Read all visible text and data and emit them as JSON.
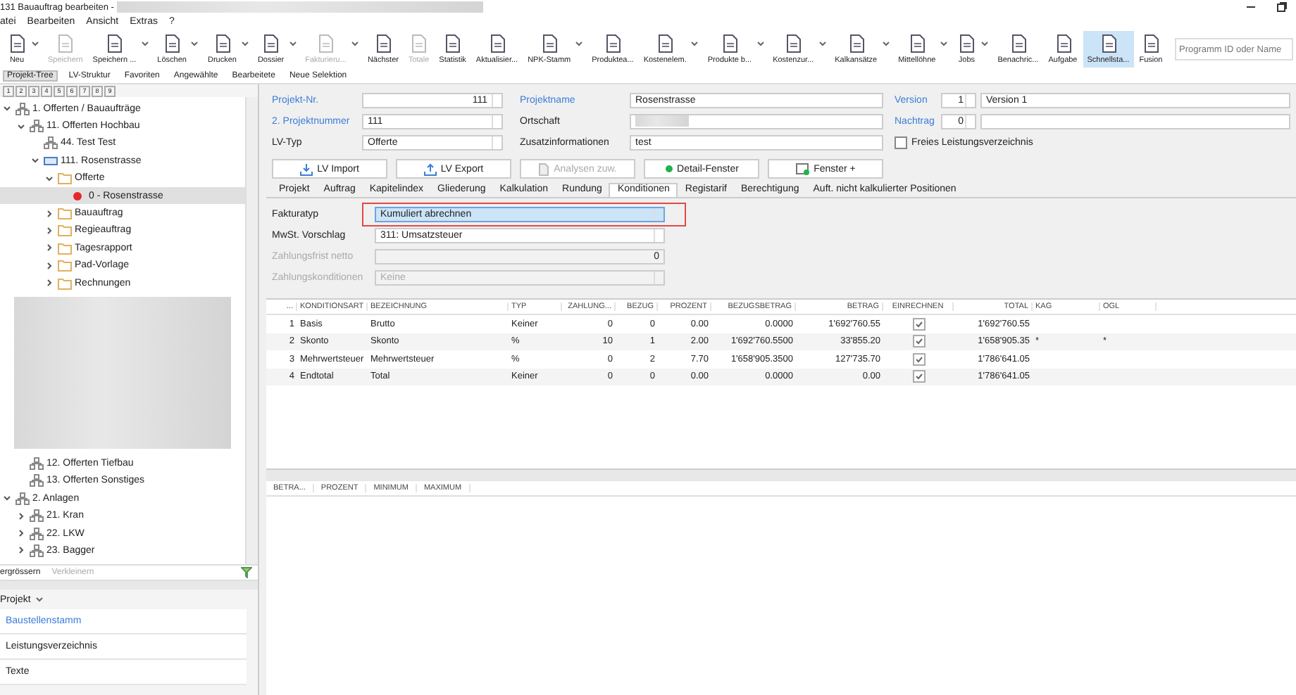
{
  "window": {
    "title": "131 Bauauftrag bearbeiten -",
    "title_obscured": true
  },
  "menu": [
    "atei",
    "Bearbeiten",
    "Ansicht",
    "Extras",
    "?"
  ],
  "toolbar": [
    {
      "label": "Neu",
      "dropdown": true,
      "disabled": false,
      "selected": false
    },
    {
      "label": "Speichern",
      "dropdown": false,
      "disabled": true,
      "selected": false
    },
    {
      "label": "Speichern ...",
      "dropdown": true,
      "disabled": false,
      "selected": false
    },
    {
      "label": "Löschen",
      "dropdown": true,
      "disabled": false,
      "selected": false
    },
    {
      "label": "Drucken",
      "dropdown": true,
      "disabled": false,
      "selected": false
    },
    {
      "label": "Dossier",
      "dropdown": true,
      "disabled": false,
      "selected": false
    },
    {
      "label": "Fakturieru...",
      "dropdown": true,
      "disabled": true,
      "selected": false
    },
    {
      "label": "Nächster",
      "dropdown": false,
      "disabled": false,
      "selected": false
    },
    {
      "label": "Totale",
      "dropdown": false,
      "disabled": true,
      "selected": false
    },
    {
      "label": "Statistik",
      "dropdown": false,
      "disabled": false,
      "selected": false
    },
    {
      "label": "Aktualisier...",
      "dropdown": false,
      "disabled": false,
      "selected": false
    },
    {
      "label": "NPK-Stamm",
      "dropdown": true,
      "disabled": false,
      "selected": false
    },
    {
      "label": "Produktea...",
      "dropdown": false,
      "disabled": false,
      "selected": false
    },
    {
      "label": "Kostenelem.",
      "dropdown": true,
      "disabled": false,
      "selected": false
    },
    {
      "label": "Produkte b...",
      "dropdown": true,
      "disabled": false,
      "selected": false
    },
    {
      "label": "Kostenzur...",
      "dropdown": true,
      "disabled": false,
      "selected": false
    },
    {
      "label": "Kalkansätze",
      "dropdown": true,
      "disabled": false,
      "selected": false
    },
    {
      "label": "Mittellöhne",
      "dropdown": true,
      "disabled": false,
      "selected": false
    },
    {
      "label": "Jobs",
      "dropdown": true,
      "disabled": false,
      "selected": false
    },
    {
      "label": "Benachric...",
      "dropdown": false,
      "disabled": false,
      "selected": false
    },
    {
      "label": "Aufgabe",
      "dropdown": false,
      "disabled": false,
      "selected": false
    },
    {
      "label": "Schnellsta...",
      "dropdown": false,
      "disabled": false,
      "selected": true
    },
    {
      "label": "Fusion",
      "dropdown": false,
      "disabled": false,
      "selected": false
    }
  ],
  "program_search": {
    "placeholder": "Programm ID oder Name"
  },
  "nav_tabs": [
    {
      "label": "Projekt-Tree",
      "selected": true
    },
    {
      "label": "LV-Struktur",
      "selected": false
    },
    {
      "label": "Favoriten",
      "selected": false
    },
    {
      "label": "Angewählte",
      "selected": false
    },
    {
      "label": "Bearbeitete",
      "selected": false
    },
    {
      "label": "Neue Selektion",
      "selected": false
    }
  ],
  "level_buttons": [
    "1",
    "2",
    "3",
    "4",
    "5",
    "6",
    "7",
    "8",
    "9"
  ],
  "tree": [
    {
      "label": "1. Offerten / Bauaufträge",
      "kind": "group",
      "expanded": true,
      "selected": false,
      "children": [
        {
          "label": "11. Offerten Hochbau",
          "kind": "group",
          "expanded": true,
          "selected": false,
          "obscured_rows": true,
          "children": [
            {
              "label": "44. Test Test",
              "kind": "group",
              "selected": false
            },
            {
              "label": "111. Rosenstrasse",
              "kind": "project",
              "expanded": true,
              "selected": false,
              "children": [
                {
                  "label": "Offerte",
                  "kind": "folder",
                  "expanded": true,
                  "selected": false,
                  "children": [
                    {
                      "label": "0 - Rosenstrasse",
                      "kind": "variant",
                      "color": "#e8272a",
                      "selected": true
                    }
                  ]
                },
                {
                  "label": "Bauauftrag",
                  "kind": "folder",
                  "expanded": false,
                  "selected": false
                },
                {
                  "label": "Regieauftrag",
                  "kind": "folder",
                  "expanded": false,
                  "selected": false
                },
                {
                  "label": "Tagesrapport",
                  "kind": "folder",
                  "expanded": false,
                  "selected": false
                },
                {
                  "label": "Pad-Vorlage",
                  "kind": "folder",
                  "expanded": false,
                  "selected": false
                },
                {
                  "label": "Rechnungen",
                  "kind": "folder",
                  "expanded": false,
                  "selected": false
                }
              ]
            }
          ]
        },
        {
          "label": "12. Offerten Tiefbau",
          "kind": "group",
          "selected": false
        },
        {
          "label": "13. Offerten Sonstiges",
          "kind": "group",
          "selected": false
        }
      ]
    },
    {
      "label": "2. Anlagen",
      "kind": "group",
      "expanded": true,
      "selected": false,
      "children": [
        {
          "label": "21. Kran",
          "kind": "group",
          "expanded": false,
          "selected": false
        },
        {
          "label": "22. LKW",
          "kind": "group",
          "expanded": false,
          "selected": false
        },
        {
          "label": "23. Bagger",
          "kind": "group",
          "expanded": false,
          "selected": false
        }
      ]
    }
  ],
  "tree_actions": [
    {
      "label": "ergrössern",
      "disabled": false
    },
    {
      "label": "Verkleinern",
      "disabled": true
    }
  ],
  "section": {
    "title": "Projekt",
    "items": [
      {
        "label": "Baustellenstamm",
        "selected": true
      },
      {
        "label": "Leistungsverzeichnis",
        "selected": false
      },
      {
        "label": "Texte",
        "selected": false
      }
    ]
  },
  "form": {
    "projekt_nr": {
      "label": "Projekt-Nr.",
      "value": "111"
    },
    "projektname": {
      "label": "Projektname",
      "value": "Rosenstrasse"
    },
    "version": {
      "label": "Version",
      "value": "1",
      "text": "Version 1"
    },
    "projektnummer_2": {
      "label": "2. Projektnummer",
      "value": "111"
    },
    "ortschaft": {
      "label": "Ortschaft",
      "obscured": true
    },
    "nachtrag": {
      "label": "Nachtrag",
      "value": "0"
    },
    "lv_typ": {
      "label": "LV-Typ",
      "value": "Offerte"
    },
    "zusatz": {
      "label": "Zusatzinformationen",
      "value": "test"
    },
    "freies_lv": {
      "label": "Freies Leistungsverzeichnis",
      "checked": false
    }
  },
  "actions": [
    {
      "label": "LV Import",
      "kind": "import",
      "disabled": false
    },
    {
      "label": "LV Export",
      "kind": "export",
      "disabled": false
    },
    {
      "label": "Analysen zuw.",
      "kind": "assign",
      "disabled": true
    },
    {
      "label": "Detail-Fenster",
      "kind": "detail",
      "disabled": false
    },
    {
      "label": "Fenster +",
      "kind": "window",
      "disabled": false
    }
  ],
  "tabs": [
    {
      "label": "Projekt",
      "selected": false
    },
    {
      "label": "Auftrag",
      "selected": false
    },
    {
      "label": "Kapitelindex",
      "selected": false
    },
    {
      "label": "Gliederung",
      "selected": false
    },
    {
      "label": "Kalkulation",
      "selected": false
    },
    {
      "label": "Rundung",
      "selected": false
    },
    {
      "label": "Konditionen",
      "selected": true
    },
    {
      "label": "Registarif",
      "selected": false
    },
    {
      "label": "Berechtigung",
      "selected": false
    },
    {
      "label": "Auft. nicht kalkulierter Positionen",
      "selected": false
    }
  ],
  "conditions": [
    {
      "label": "Fakturatyp",
      "kind": "select",
      "value": "Kumuliert abrechnen",
      "disabled": false,
      "highlighted": true
    },
    {
      "label": "MwSt. Vorschlag",
      "kind": "select",
      "value": "311: Umsatzsteuer",
      "disabled": false,
      "highlighted": false
    },
    {
      "label": "Zahlungsfrist netto",
      "kind": "number",
      "value": "0",
      "disabled": true,
      "highlighted": false
    },
    {
      "label": "Zahlungskonditionen",
      "kind": "select",
      "value": "Keine",
      "disabled": true,
      "highlighted": false
    }
  ],
  "table": {
    "columns": [
      "...",
      "KONDITIONSART",
      "BEZEICHNUNG",
      "TYP",
      "ZAHLUNG...",
      "BEZUG",
      "PROZENT",
      "BEZUGSBETRAG",
      "BETRAG",
      "EINRECHNEN",
      "TOTAL",
      "KAG",
      "OGL"
    ],
    "rows": [
      {
        "cells": [
          "1",
          "Basis",
          "Brutto",
          "Keiner",
          "0",
          "0",
          "0.00",
          "0.0000",
          "1'692'760.55"
        ],
        "einrechnen": true,
        "total": "1'692'760.55"
      },
      {
        "cells": [
          "2",
          "Skonto",
          "Skonto",
          "%",
          "10",
          "1",
          "2.00",
          "1'692'760.5500",
          "33'855.20"
        ],
        "einrechnen": true,
        "total": "1'658'905.35",
        "kag": "*",
        "ogl": "*"
      },
      {
        "cells": [
          "3",
          "Mehrwertsteuer",
          "Mehrwertsteuer",
          "%",
          "0",
          "2",
          "7.70",
          "1'658'905.3500",
          "127'735.70"
        ],
        "einrechnen": true,
        "total": "1'786'641.05"
      },
      {
        "cells": [
          "4",
          "Endtotal",
          "Total",
          "Keiner",
          "0",
          "0",
          "0.00",
          "0.0000",
          "0.00"
        ],
        "einrechnen": true,
        "total": "1'786'641.05"
      }
    ]
  },
  "sub_table": {
    "columns": [
      "BETRA...",
      "PROZENT",
      "MINIMUM",
      "MAXIMUM"
    ]
  }
}
